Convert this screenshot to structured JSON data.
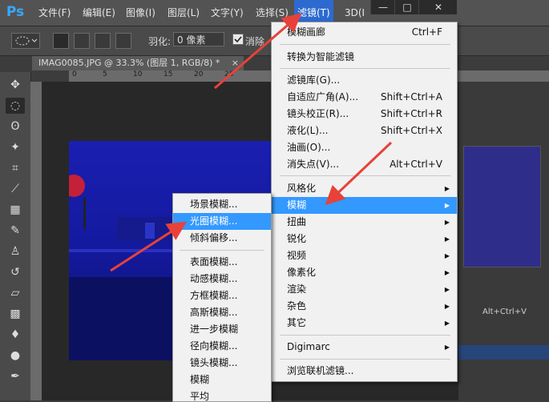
{
  "app": {
    "logo": "Ps"
  },
  "menubar": {
    "items": [
      {
        "label": "文件(F)"
      },
      {
        "label": "编辑(E)"
      },
      {
        "label": "图像(I)"
      },
      {
        "label": "图层(L)"
      },
      {
        "label": "文字(Y)"
      },
      {
        "label": "选择(S)"
      },
      {
        "label": "滤镜(T)",
        "active": true
      },
      {
        "label": "3D(I"
      }
    ]
  },
  "window_controls": {
    "minimize": "—",
    "maximize": "□",
    "close": "✕"
  },
  "options_bar": {
    "feather_label": "羽化:",
    "feather_value": "0 像素",
    "antialias_label": "消除"
  },
  "document": {
    "tab_title": "IMAG0085.JPG @ 33.3% (图层 1, RGB/8) *",
    "tab_close": "×",
    "ruler_ticks": [
      "0",
      "5",
      "10",
      "15",
      "20",
      "25"
    ]
  },
  "filter_menu": {
    "items": [
      {
        "label": "模糊画廊",
        "shortcut": "Ctrl+F"
      },
      {
        "separator": true
      },
      {
        "label": "转换为智能滤镜"
      },
      {
        "separator": true
      },
      {
        "label": "滤镜库(G)..."
      },
      {
        "label": "自适应广角(A)...",
        "shortcut": "Shift+Ctrl+A"
      },
      {
        "label": "镜头校正(R)...",
        "shortcut": "Shift+Ctrl+R"
      },
      {
        "label": "液化(L)...",
        "shortcut": "Shift+Ctrl+X"
      },
      {
        "label": "油画(O)..."
      },
      {
        "label": "消失点(V)...",
        "shortcut": "Alt+Ctrl+V"
      },
      {
        "separator": true
      },
      {
        "label": "风格化",
        "submenu": true
      },
      {
        "label": "模糊",
        "submenu": true,
        "highlighted": true
      },
      {
        "label": "扭曲",
        "submenu": true
      },
      {
        "label": "锐化",
        "submenu": true
      },
      {
        "label": "视频",
        "submenu": true
      },
      {
        "label": "像素化",
        "submenu": true
      },
      {
        "label": "渲染",
        "submenu": true
      },
      {
        "label": "杂色",
        "submenu": true
      },
      {
        "label": "其它",
        "submenu": true
      },
      {
        "separator": true
      },
      {
        "label": "Digimarc",
        "submenu": true
      },
      {
        "separator": true
      },
      {
        "label": "浏览联机滤镜..."
      }
    ]
  },
  "blur_submenu": {
    "items": [
      {
        "label": "场景模糊..."
      },
      {
        "label": "光圈模糊...",
        "highlighted": true
      },
      {
        "label": "倾斜偏移..."
      },
      {
        "separator": true
      },
      {
        "label": "表面模糊..."
      },
      {
        "label": "动感模糊..."
      },
      {
        "label": "方框模糊..."
      },
      {
        "label": "高斯模糊..."
      },
      {
        "label": "进一步模糊"
      },
      {
        "label": "径向模糊..."
      },
      {
        "label": "镜头模糊..."
      },
      {
        "label": "模糊"
      },
      {
        "label": "平均"
      }
    ]
  },
  "right_panel": {
    "shortcut_hint": "Alt+Ctrl+V"
  },
  "colors": {
    "accent": "#3399ff",
    "arrow": "#e8413a",
    "photo": "#1a1fb0"
  }
}
